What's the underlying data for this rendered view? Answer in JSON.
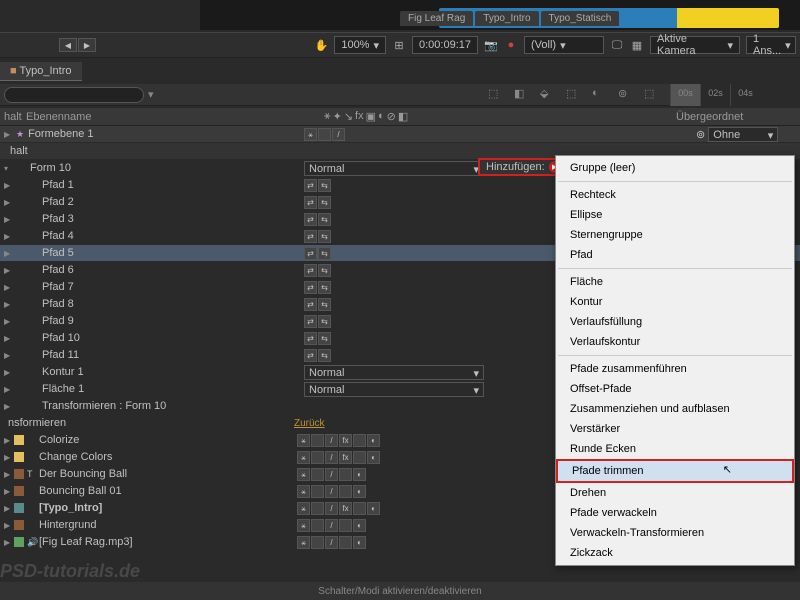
{
  "tabs": [
    "Fig Leaf Rag",
    "Typo_Intro",
    "Typo_Statisch"
  ],
  "controls": {
    "zoom": "100%",
    "timecode": "0:00:09:17",
    "quality": "(Voll)",
    "camera": "Aktive Kamera",
    "views": "1 Ans..."
  },
  "comp_tab": "Typo_Intro",
  "timeline_marks": [
    "00s",
    "02s",
    "04s"
  ],
  "headers": {
    "name": "Ebenenname",
    "parent": "Übergeordnet",
    "content": "halt"
  },
  "main_layer": {
    "name": "Formebene 1",
    "parent": "Ohne"
  },
  "add_button": "Hinzufügen:",
  "form_group": "Form 10",
  "mode_normal": "Normal",
  "paths": [
    "Pfad 1",
    "Pfad 2",
    "Pfad 3",
    "Pfad 4",
    "Pfad 5",
    "Pfad 6",
    "Pfad 7",
    "Pfad 8",
    "Pfad 9",
    "Pfad 10",
    "Pfad 11"
  ],
  "extras": [
    "Kontur 1",
    "Fläche 1"
  ],
  "transform_group": "Transformieren : Form 10",
  "transform_label": "nsformieren",
  "reset_link": "Zurück",
  "effect_layers": [
    {
      "name": "Colorize",
      "chip": "#e0c060"
    },
    {
      "name": "Change Colors",
      "chip": "#e0c060"
    },
    {
      "name": "Der Bouncing Ball",
      "chip": "#8a5a3a",
      "type": "text"
    },
    {
      "name": "Bouncing Ball 01",
      "chip": "#8a5a3a"
    },
    {
      "name": "[Typo_Intro]",
      "chip": "#5a8a8a",
      "comp": true
    },
    {
      "name": "Hintergrund",
      "chip": "#8a5a3a"
    },
    {
      "name": "[Fig Leaf Rag.mp3]",
      "chip": "#60a060",
      "audio": true
    }
  ],
  "menu": {
    "group1": [
      "Gruppe (leer)"
    ],
    "group2": [
      "Rechteck",
      "Ellipse",
      "Sternengruppe",
      "Pfad"
    ],
    "group3": [
      "Fläche",
      "Kontur",
      "Verlaufsfüllung",
      "Verlaufskontur"
    ],
    "group4": [
      "Pfade zusammenführen",
      "Offset-Pfade",
      "Zusammenziehen und aufblasen",
      "Verstärker",
      "Runde Ecken",
      "Pfade trimmen",
      "Drehen",
      "Pfade verwackeln",
      "Verwackeln-Transformieren",
      "Zickzack"
    ]
  },
  "highlighted_menu": "Pfade trimmen",
  "footer": "Schalter/Modi aktivieren/deaktivieren",
  "watermark": "PSD-tutorials.de"
}
